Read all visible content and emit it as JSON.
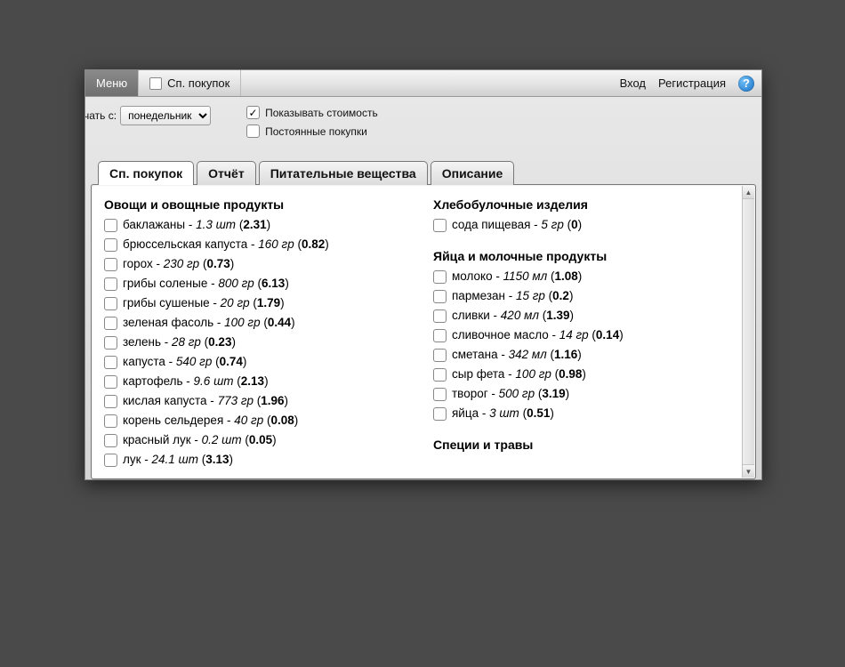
{
  "topbar": {
    "menu_label": "Меню",
    "shoplist_tab_label": "Сп. покупок",
    "login_label": "Вход",
    "register_label": "Регистрация",
    "help_glyph": "?"
  },
  "options": {
    "start_label_prefix": "чать с:",
    "start_value": "понедельник",
    "show_cost_label": "Показывать стоимость",
    "show_cost_checked": true,
    "permanent_label": "Постоянные покупки",
    "permanent_checked": false
  },
  "tabs": {
    "shoplist": "Сп. покупок",
    "report": "Отчёт",
    "nutrients": "Питательные вещества",
    "description": "Описание"
  },
  "shopping": {
    "left": [
      {
        "title": "Овощи и овощные продукты",
        "items": [
          {
            "name": "баклажаны",
            "qty": "1.3 шт",
            "price": "2.31"
          },
          {
            "name": "брюссельская капуста",
            "qty": "160 гр",
            "price": "0.82"
          },
          {
            "name": "горох",
            "qty": "230 гр",
            "price": "0.73"
          },
          {
            "name": "грибы соленые",
            "qty": "800 гр",
            "price": "6.13"
          },
          {
            "name": "грибы сушеные",
            "qty": "20 гр",
            "price": "1.79"
          },
          {
            "name": "зеленая фасоль",
            "qty": "100 гр",
            "price": "0.44"
          },
          {
            "name": "зелень",
            "qty": "28 гр",
            "price": "0.23"
          },
          {
            "name": "капуста",
            "qty": "540 гр",
            "price": "0.74"
          },
          {
            "name": "картофель",
            "qty": "9.6 шт",
            "price": "2.13"
          },
          {
            "name": "кислая капуста",
            "qty": "773 гр",
            "price": "1.96"
          },
          {
            "name": "корень сельдерея",
            "qty": "40 гр",
            "price": "0.08"
          },
          {
            "name": "красный лук",
            "qty": "0.2 шт",
            "price": "0.05"
          },
          {
            "name": "лук",
            "qty": "24.1 шт",
            "price": "3.13"
          }
        ]
      }
    ],
    "right": [
      {
        "title": "Хлебобулочные изделия",
        "items": [
          {
            "name": "сода пищевая",
            "qty": "5 гр",
            "price": "0"
          }
        ]
      },
      {
        "title": "Яйца и молочные продукты",
        "items": [
          {
            "name": "молоко",
            "qty": "1150 мл",
            "price": "1.08"
          },
          {
            "name": "пармезан",
            "qty": "15 гр",
            "price": "0.2"
          },
          {
            "name": "сливки",
            "qty": "420 мл",
            "price": "1.39"
          },
          {
            "name": "сливочное масло",
            "qty": "14 гр",
            "price": "0.14"
          },
          {
            "name": "сметана",
            "qty": "342 мл",
            "price": "1.16"
          },
          {
            "name": "сыр фета",
            "qty": "100 гр",
            "price": "0.98"
          },
          {
            "name": "творог",
            "qty": "500 гр",
            "price": "3.19"
          },
          {
            "name": "яйца",
            "qty": "3 шт",
            "price": "0.51"
          }
        ]
      },
      {
        "title": "Специи и травы",
        "items": []
      }
    ]
  }
}
